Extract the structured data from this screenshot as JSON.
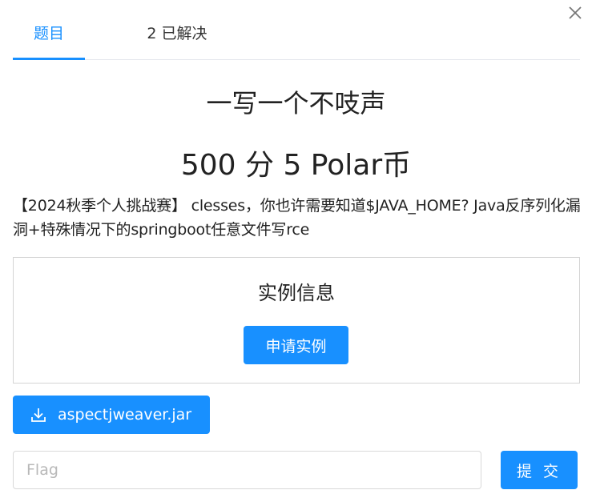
{
  "dialog": {
    "close_icon": "close-icon"
  },
  "tabs": [
    {
      "label": "题目",
      "active": true
    },
    {
      "label": "2 已解决",
      "active": false
    }
  ],
  "challenge": {
    "title": "一写一个不吱声",
    "score": "500 分 5 Polar币",
    "description": "【2024秋季个人挑战赛】 clesses，你也许需要知道$JAVA_HOME? Java反序列化漏洞+特殊情况下的springboot任意文件写rce"
  },
  "instance": {
    "title": "实例信息",
    "apply_label": "申请实例"
  },
  "attachment": {
    "icon": "download-icon",
    "filename": "aspectjweaver.jar"
  },
  "flag": {
    "placeholder": "Flag",
    "value": "",
    "submit_label": "提 交"
  },
  "colors": {
    "accent": "#1890ff",
    "border": "#d4d4d4"
  }
}
